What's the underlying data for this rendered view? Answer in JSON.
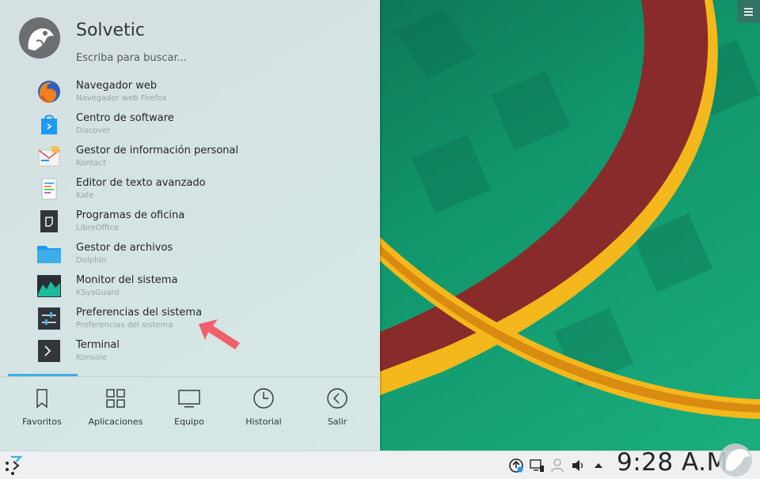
{
  "user": {
    "name": "Solvetic"
  },
  "search": {
    "placeholder": "Escriba para buscar..."
  },
  "favorites": [
    {
      "title": "Navegador web",
      "subtitle": "Navegador web Firefox",
      "icon": "firefox-icon"
    },
    {
      "title": "Centro de software",
      "subtitle": "Discover",
      "icon": "discover-icon"
    },
    {
      "title": "Gestor de información personal",
      "subtitle": "Kontact",
      "icon": "kontact-icon"
    },
    {
      "title": "Editor de texto avanzado",
      "subtitle": "Kate",
      "icon": "kate-icon"
    },
    {
      "title": "Programas de oficina",
      "subtitle": "LibreOffice",
      "icon": "libreoffice-icon"
    },
    {
      "title": "Gestor de archivos",
      "subtitle": "Dolphin",
      "icon": "folder-icon"
    },
    {
      "title": "Monitor del sistema",
      "subtitle": "KSysGuard",
      "icon": "ksysguard-icon"
    },
    {
      "title": "Preferencias del sistema",
      "subtitle": "Preferencias del sistema",
      "icon": "system-settings-icon"
    },
    {
      "title": "Terminal",
      "subtitle": "Konsole",
      "icon": "terminal-icon"
    }
  ],
  "tabs": [
    {
      "label": "Favoritos",
      "icon": "bookmark-icon",
      "active": true
    },
    {
      "label": "Aplicaciones",
      "icon": "grid-icon"
    },
    {
      "label": "Equipo",
      "icon": "monitor-icon"
    },
    {
      "label": "Historial",
      "icon": "clock-icon"
    },
    {
      "label": "Salir",
      "icon": "back-circle-icon"
    }
  ],
  "taskbar": {
    "clock": "9:28 A.M.",
    "tray_icons": [
      "update-icon",
      "network-icon",
      "user-icon",
      "volume-icon",
      "expand-arrow-icon"
    ]
  },
  "colors": {
    "accent": "#3daee9",
    "arrow": "#f0606a",
    "panel": "#eff0f1"
  }
}
